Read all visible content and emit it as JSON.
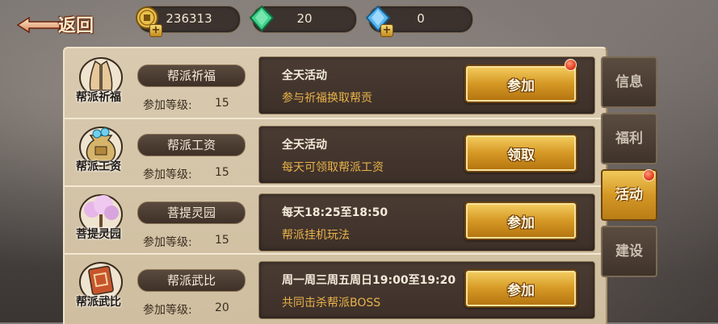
{
  "header": {
    "back_label": "返回",
    "currencies": [
      {
        "icon": "gold-coin-icon",
        "value": "236313"
      },
      {
        "icon": "green-gem-icon",
        "value": "20"
      },
      {
        "icon": "blue-gem-icon",
        "value": "0"
      }
    ]
  },
  "activities": [
    {
      "emblem_text": "帮派祈福",
      "name": "帮派祈福",
      "level_label": "参加等级:",
      "level": "15",
      "time": "全天活动",
      "desc": "参与祈福换取帮贡",
      "button": "参加",
      "has_badge": true
    },
    {
      "emblem_text": "帮派工资",
      "name": "帮派工资",
      "level_label": "参加等级:",
      "level": "15",
      "time": "全天活动",
      "desc": "每天可领取帮派工资",
      "button": "领取",
      "has_badge": false
    },
    {
      "emblem_text": "菩提灵园",
      "name": "菩提灵园",
      "level_label": "参加等级:",
      "level": "15",
      "time": "每天18:25至18:50",
      "desc": "帮派挂机玩法",
      "button": "参加",
      "has_badge": false
    },
    {
      "emblem_text": "帮派武比",
      "name": "帮派武比",
      "level_label": "参加等级:",
      "level": "20",
      "time": "周一周三周五周日19:00至19:20",
      "desc": "共同击杀帮派BOSS",
      "button": "参加",
      "has_badge": false
    }
  ],
  "side_tabs": [
    {
      "label": "信息",
      "active": false
    },
    {
      "label": "福利",
      "active": false
    },
    {
      "label": "活动",
      "active": true,
      "has_badge": true
    },
    {
      "label": "建设",
      "active": false
    }
  ],
  "colors": {
    "accent_gold": "#d79a26",
    "desc_text": "#e9b24a",
    "badge_red": "#e2401f"
  }
}
